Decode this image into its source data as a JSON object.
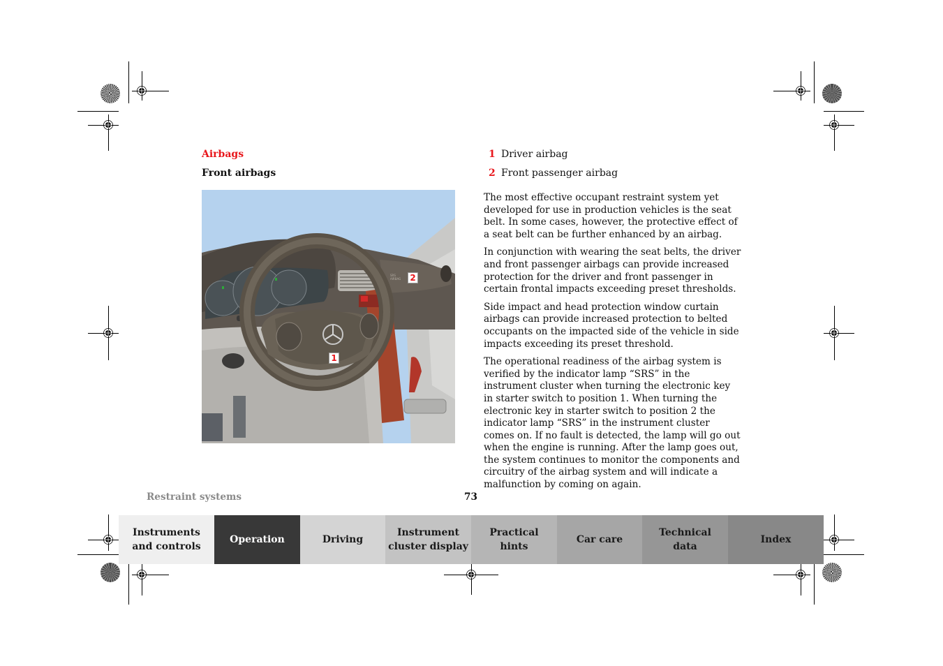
{
  "page": {
    "section_title": "Airbags",
    "subsection_title": "Front airbags",
    "legend": [
      {
        "number": "1",
        "label": "Driver airbag"
      },
      {
        "number": "2",
        "label": "Front passenger airbag"
      }
    ],
    "paragraphs": [
      "The most effective occupant restraint system yet developed for use in production vehicles is the seat belt. In some cases, however, the protective effect of a seat belt can be further enhanced by an airbag.",
      "In conjunction with wearing the seat belts, the driver and front passenger airbags can provide increased protection for the driver and front passenger in certain frontal impacts exceeding preset thresholds.",
      "Side impact and head protection window curtain airbags can provide increased protection to belted occupants on the impacted side of the vehicle in side impacts exceeding its preset threshold.",
      "The operational readiness of the airbag system is verified by the indicator lamp “SRS” in the instrument cluster when turning the electronic key in starter switch to position 1. When turning the electronic key in starter switch to position 2 the indicator lamp “SRS” in the instrument cluster comes on. If no fault is detected, the lamp will go out when the engine is running. After the lamp goes out, the system continues to monitor the components and circuitry of the airbag system and will indicate a malfunction by coming on again."
    ],
    "illustration": {
      "description": "Dashboard with steering wheel showing driver and passenger airbag locations",
      "callouts": [
        "1",
        "2"
      ],
      "passenger_panel_label": "SRS AIRBAG"
    },
    "footer": {
      "section_name": "Restraint systems",
      "page_number": "73"
    }
  },
  "nav_tabs": [
    {
      "line1": "Instruments",
      "line2": "and controls",
      "bg": "#efefef",
      "active": false
    },
    {
      "line1": "Operation",
      "line2": "",
      "bg": "#383838",
      "active": true
    },
    {
      "line1": "Driving",
      "line2": "",
      "bg": "#d4d4d4",
      "active": false
    },
    {
      "line1": "Instrument",
      "line2": "cluster display",
      "bg": "#c3c3c3",
      "active": false
    },
    {
      "line1": "Practical hints",
      "line2": "",
      "bg": "#b5b5b5",
      "active": false
    },
    {
      "line1": "Car care",
      "line2": "",
      "bg": "#a6a6a6",
      "active": false
    },
    {
      "line1": "Technical",
      "line2": "data",
      "bg": "#969696",
      "active": false
    },
    {
      "line1": "Index",
      "line2": "",
      "bg": "#888888",
      "active": false
    }
  ],
  "colors": {
    "accent_red": "#e8161b",
    "footer_gray": "#8a8a8a",
    "sky": "#b5d2ee"
  }
}
